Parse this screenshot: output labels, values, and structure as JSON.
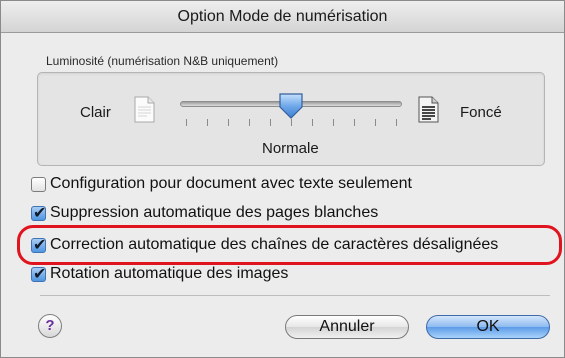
{
  "window": {
    "title": "Option Mode de numérisation"
  },
  "brightness": {
    "group_label": "Luminosité (numérisation N&B uniquement)",
    "light_label": "Clair",
    "dark_label": "Foncé",
    "value_label": "Normale",
    "slider_value": 0.5
  },
  "options": [
    {
      "label": "Configuration pour document avec texte seulement",
      "checked": false
    },
    {
      "label": "Suppression automatique des pages blanches",
      "checked": true
    },
    {
      "label": "Correction automatique des chaînes de caractères désalignées",
      "checked": true,
      "highlighted": true
    },
    {
      "label": "Rotation automatique des images",
      "checked": true
    }
  ],
  "buttons": {
    "help": "?",
    "cancel": "Annuler",
    "ok": "OK"
  },
  "colors": {
    "highlight": "#e0141e",
    "default_button": "#5d9be8",
    "checkbox_checked": "#4f95e0"
  }
}
